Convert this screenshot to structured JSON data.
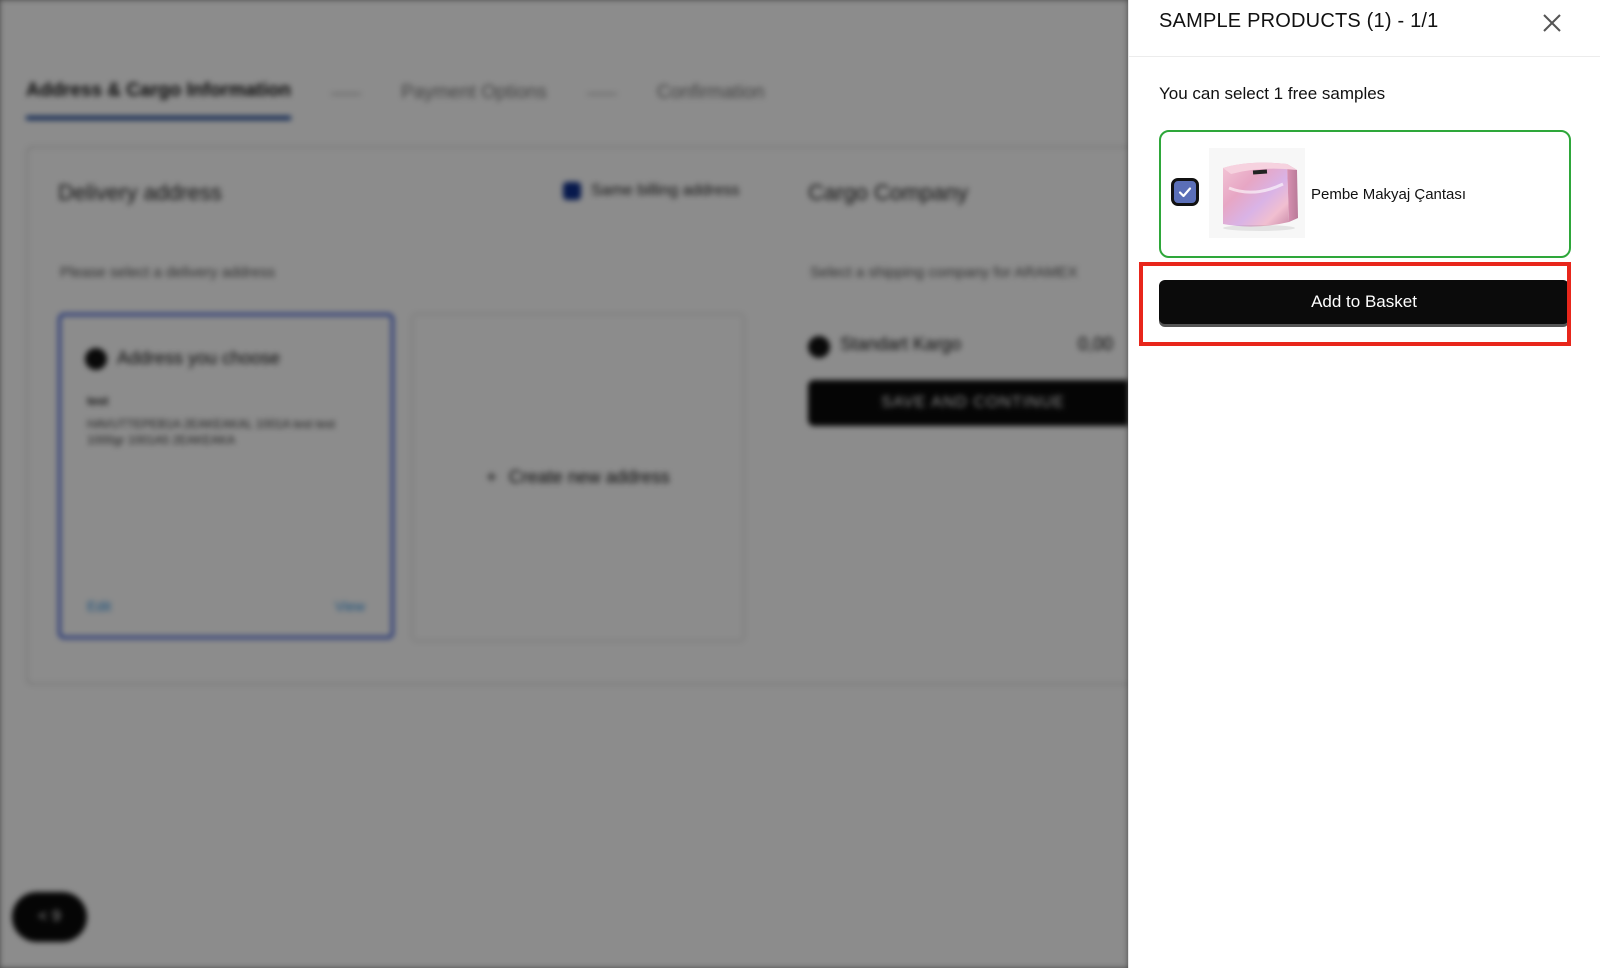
{
  "background": {
    "steps": [
      {
        "label": "Address & Cargo Information"
      },
      {
        "label": "Payment Options"
      },
      {
        "label": "Confirmation"
      }
    ],
    "delivery_title": "Delivery address",
    "same_billing_label": "Same billing address",
    "delivery_hint": "Please select a delivery address",
    "address_card": {
      "title": "Address you choose",
      "name": "test",
      "line": "HAVUTTEPEB1A 2EAKEAKAL 1001A test test 1000gr 1001A5 2EAKEAKA",
      "edit_label": "Edit",
      "view_label": "View"
    },
    "create_new_label": "Create new address",
    "cargo_title": "Cargo Company",
    "cargo_hint": "Select a shipping company for ARAMEX",
    "cargo_option": {
      "name": "Standart Kargo",
      "price": "0,00"
    },
    "save_label": "SAVE AND CONTINUE",
    "chat_label": "< 9"
  },
  "drawer": {
    "title": "SAMPLE PRODUCTS (1) - 1/1",
    "subtitle": "You can select 1 free samples",
    "product": {
      "name": "Pembe Makyaj Çantası",
      "selected": true,
      "image_icon": "pink-makeup-bag-image"
    },
    "add_button_label": "Add to Basket",
    "close_icon": "close-icon"
  },
  "colors": {
    "selected_border": "#2ea73a",
    "checkbox_fill": "#5b6fb8",
    "button_bg": "#0b0b0b",
    "highlight": "#e8261b"
  }
}
